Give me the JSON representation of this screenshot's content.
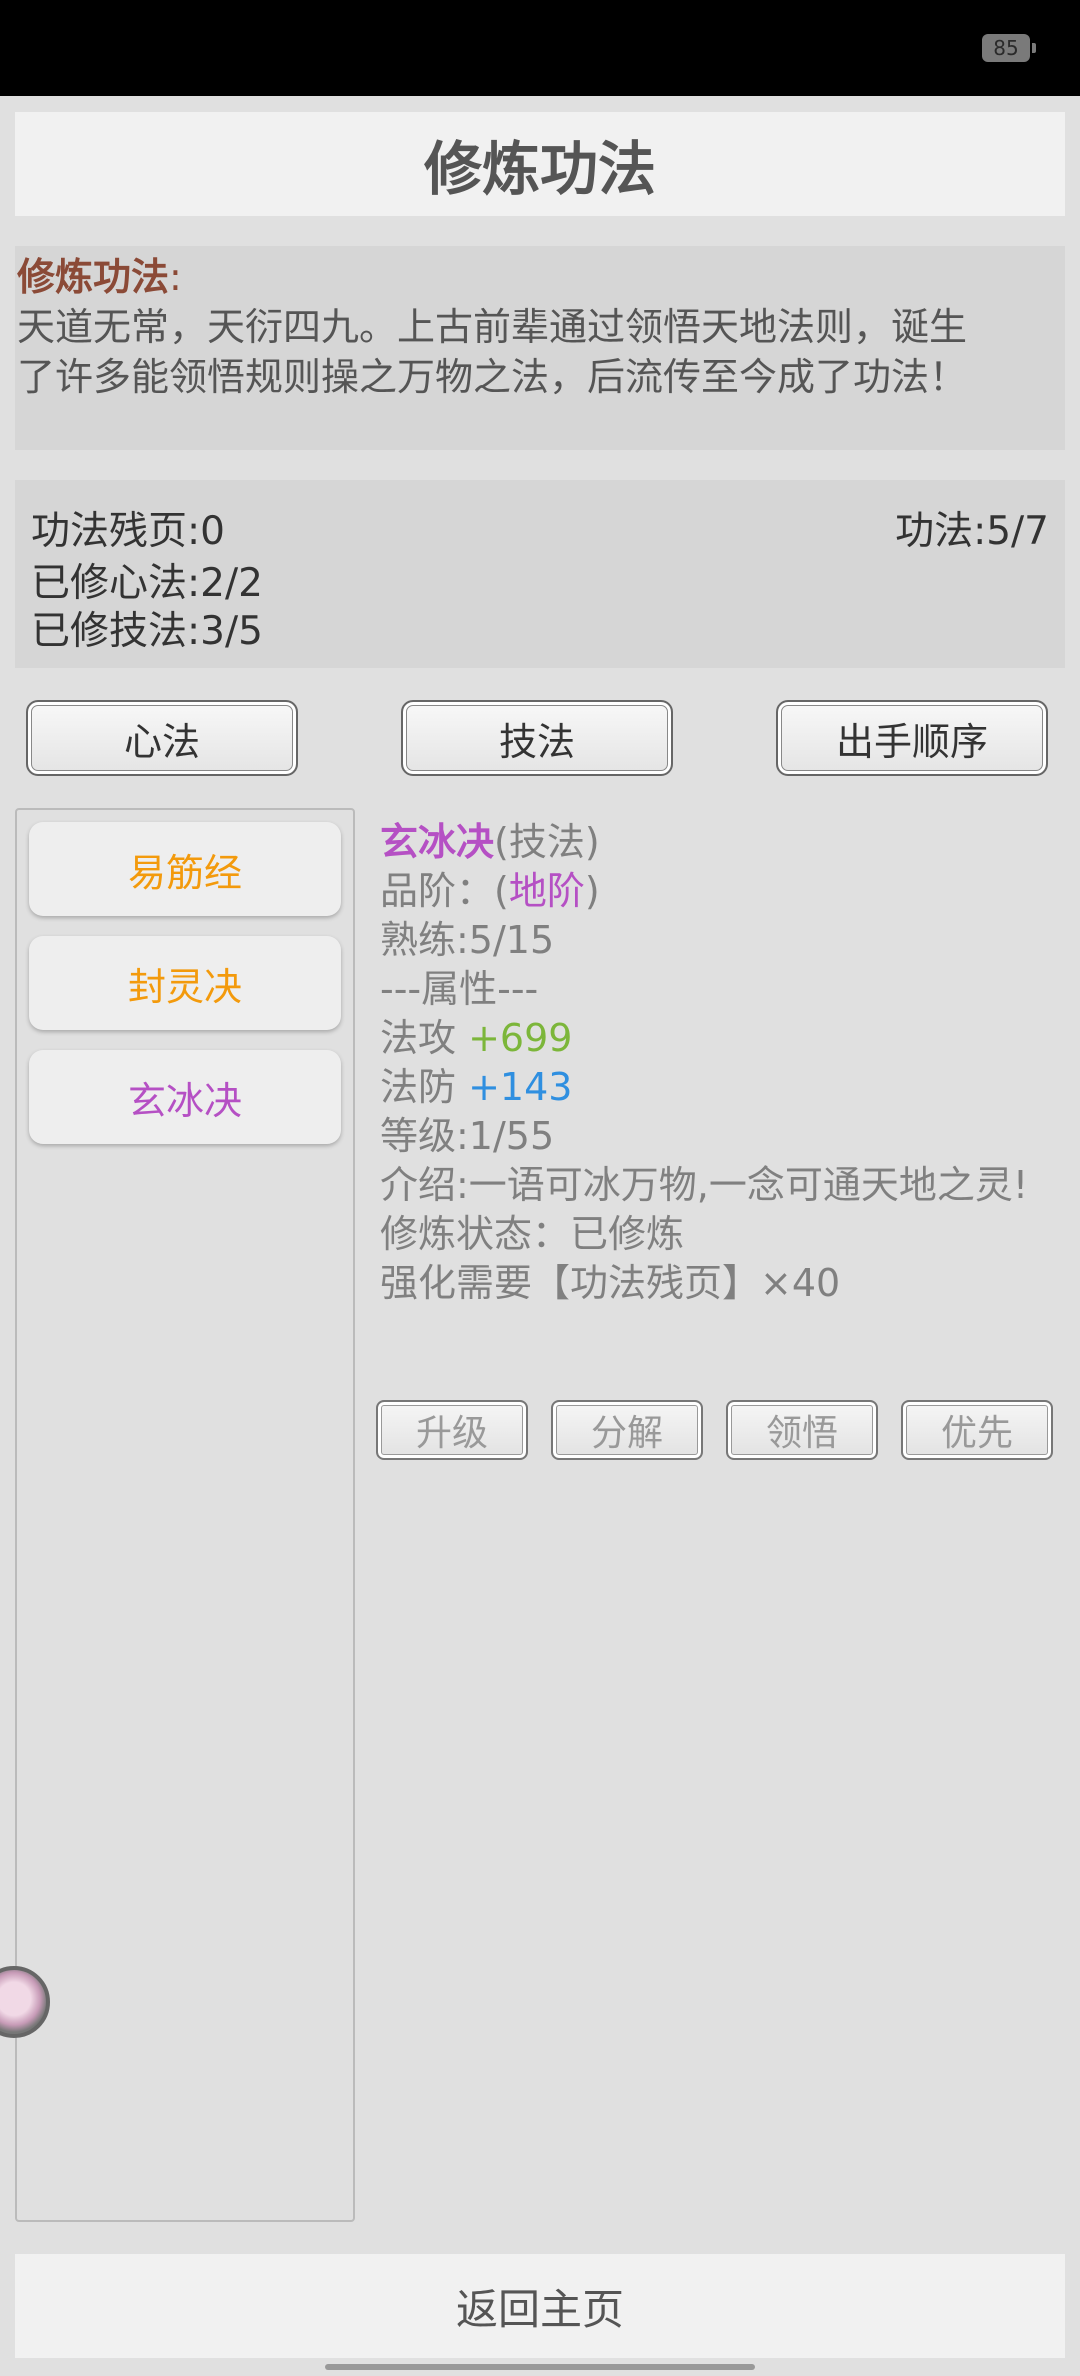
{
  "status_bar": {
    "battery": "85"
  },
  "header": {
    "title": "修炼功法"
  },
  "description": {
    "title": "修炼功法",
    "colon": ":",
    "line1": "天道无常，天衍四九。上古前辈通过领悟天地法则，诞生",
    "line2": "了许多能领悟规则操之万物之法，后流传至今成了功法！"
  },
  "stats": {
    "fragments": "功法残页:0",
    "skills": "功法:5/7",
    "mind": "已修心法:2/2",
    "tech": "已修技法:3/5"
  },
  "tabs": {
    "mind_methods": "心法",
    "techniques": "技法",
    "order": "出手顺序"
  },
  "skill_list": [
    {
      "name": "易筋经",
      "color": "#f39a0c"
    },
    {
      "name": "封灵决",
      "color": "#f39a0c"
    },
    {
      "name": "玄冰决",
      "color": "#b550c4"
    }
  ],
  "detail": {
    "name": "玄冰决",
    "name_color": "#b550c4",
    "type": "(技法)",
    "grade_label": "品阶：(",
    "grade_value": "地阶",
    "grade_close": ")",
    "proficiency": "熟练:5/15",
    "attr_header": "---属性---",
    "atk_label": "法攻 ",
    "atk_value": "+699",
    "atk_color": "#7cb63a",
    "def_label": "法防 ",
    "def_value": "+143",
    "def_color": "#2f8fe0",
    "level": "等级:1/55",
    "intro": "介绍:一语可冰万物,一念可通天地之灵!",
    "status": "修炼状态：已修炼",
    "upgrade_cost": "强化需要【功法残页】×40"
  },
  "actions": {
    "upgrade": "升级",
    "decompose": "分解",
    "comprehend": "领悟",
    "priority": "优先"
  },
  "footer": {
    "home": "返回主页"
  }
}
